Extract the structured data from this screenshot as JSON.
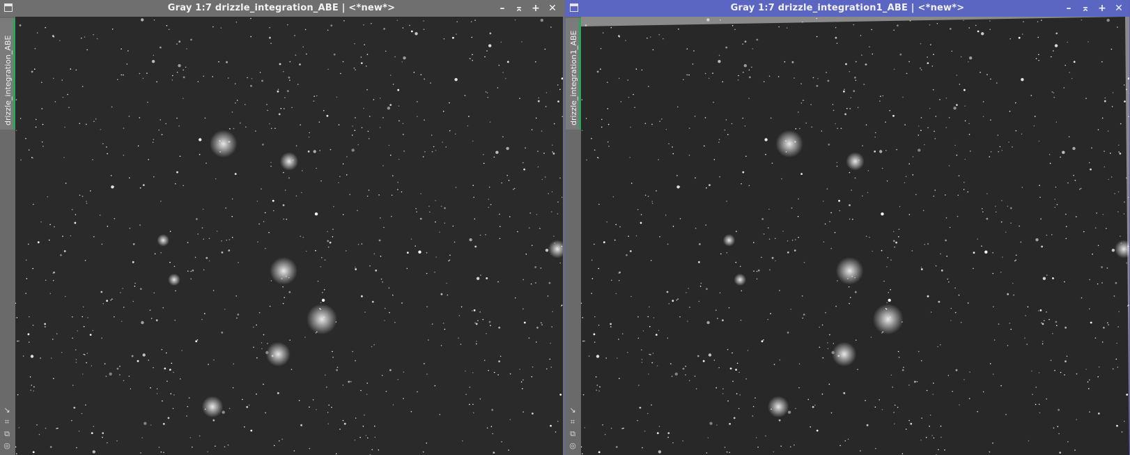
{
  "windows": [
    {
      "title": "Gray 1:7 drizzle_integration_ABE | <*new*>",
      "tab_label": "drizzle_integration_ABE",
      "active": false,
      "controls": [
        "minimize-icon",
        "shade-icon",
        "maximize-icon",
        "close-icon"
      ]
    },
    {
      "title": "Gray 1:7 drizzle_integration1_ABE | <*new*>",
      "tab_label": "drizzle_integration1_ABE",
      "active": true,
      "controls": [
        "minimize-icon",
        "shade-icon",
        "maximize-icon",
        "close-icon"
      ]
    }
  ],
  "side_icons": [
    "arrow-diagonal-icon",
    "zoom-fit-icon",
    "clone-icon",
    "target-icon"
  ],
  "colors": {
    "active_titlebar": "#5b66c2",
    "inactive_titlebar": "#6f6f6f",
    "tab_accent": "#2fa35a",
    "image_background": "#2b2b2b"
  }
}
